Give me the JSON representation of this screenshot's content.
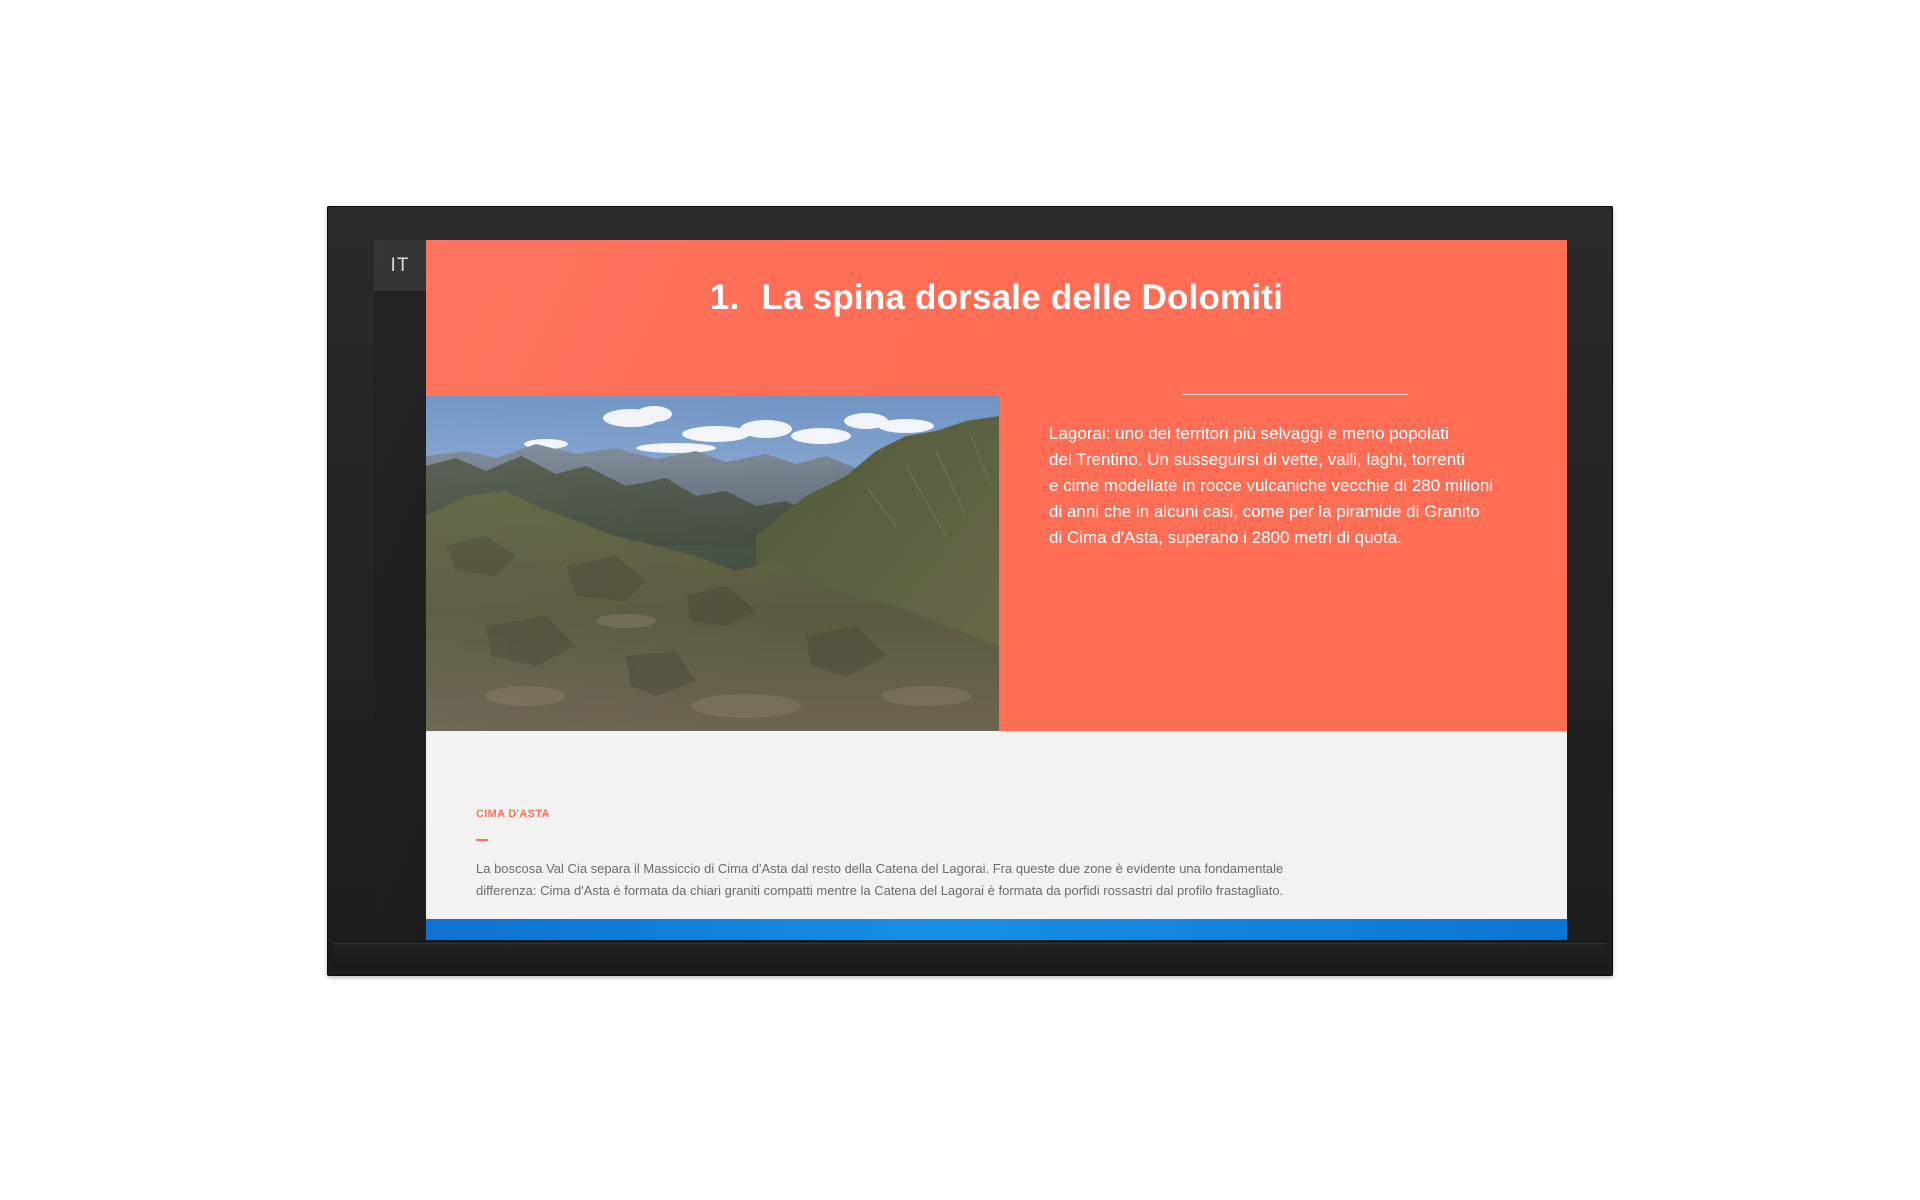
{
  "language": {
    "current": "IT"
  },
  "hero": {
    "number": "1.",
    "title": "La spina dorsale delle Dolomiti",
    "image_icon": "mountain-landscape-image",
    "intro_lines": [
      "Lagorai: uno dei territori più selvaggi e meno popolati",
      "del Trentino. Un susseguirsi di vette, valli, laghi, torrenti",
      "e cime modellate in rocce vulcaniche vecchie di 280 milioni",
      "di anni che in alcuni casi, come per la piramide di Granito",
      "di Cima d'Asta, superano i 2800 metri di quota."
    ]
  },
  "info": {
    "label": "CIMA D'ASTA",
    "lines": [
      "La boscosa Val Cia separa il Massiccio di Cima d'Asta dal resto della Catena del Lagorai. Fra queste due zone è evidente una fondamentale",
      "differenza: Cima d'Asta è formata da chiari graniti compatti mentre la Catena del Lagorai è formata da porfidi rossastri dal profilo frastagliato."
    ]
  },
  "colors": {
    "accent": "#ff6d55",
    "panel": "#f2f2f2",
    "bar": "#1690e6",
    "bezel": "#1c1c1c"
  }
}
